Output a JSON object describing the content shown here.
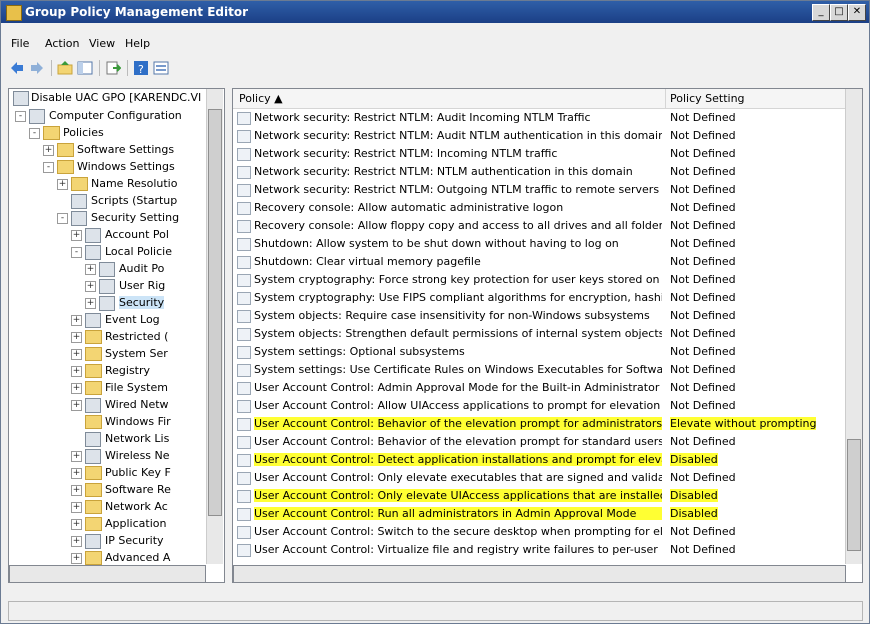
{
  "window": {
    "title": "Group Policy Management Editor"
  },
  "menu": [
    "File",
    "Action",
    "View",
    "Help"
  ],
  "tree": {
    "root": "Disable UAC GPO [KARENDC.VI",
    "items": [
      "Computer Configuration",
      "Policies",
      "Software Settings",
      "Windows Settings",
      "Name Resolutio",
      "Scripts (Startup",
      "Security Setting",
      "Account Pol",
      "Local Policie",
      "Audit Po",
      "User Rig",
      "Security",
      "Event Log",
      "Restricted (",
      "System Ser",
      "Registry",
      "File System",
      "Wired Netw",
      "Windows Fir",
      "Network Lis",
      "Wireless Ne",
      "Public Key F",
      "Software Re",
      "Network Ac",
      "Application",
      "IP Security",
      "Advanced A"
    ]
  },
  "list": {
    "headers": {
      "policy": "Policy",
      "setting": "Policy Setting"
    },
    "rows": [
      {
        "policy": "Network security: Restrict NTLM: Audit Incoming NTLM Traffic",
        "setting": "Not Defined"
      },
      {
        "policy": "Network security: Restrict NTLM: Audit NTLM authentication in this domain",
        "setting": "Not Defined"
      },
      {
        "policy": "Network security: Restrict NTLM: Incoming NTLM traffic",
        "setting": "Not Defined"
      },
      {
        "policy": "Network security: Restrict NTLM: NTLM authentication in this domain",
        "setting": "Not Defined"
      },
      {
        "policy": "Network security: Restrict NTLM: Outgoing NTLM traffic to remote servers",
        "setting": "Not Defined"
      },
      {
        "policy": "Recovery console: Allow automatic administrative logon",
        "setting": "Not Defined"
      },
      {
        "policy": "Recovery console: Allow floppy copy and access to all drives and all folders",
        "setting": "Not Defined"
      },
      {
        "policy": "Shutdown: Allow system to be shut down without having to log on",
        "setting": "Not Defined"
      },
      {
        "policy": "Shutdown: Clear virtual memory pagefile",
        "setting": "Not Defined"
      },
      {
        "policy": "System cryptography: Force strong key protection for user keys stored on t...",
        "setting": "Not Defined"
      },
      {
        "policy": "System cryptography: Use FIPS compliant algorithms for encryption, hashin...",
        "setting": "Not Defined"
      },
      {
        "policy": "System objects: Require case insensitivity for non-Windows subsystems",
        "setting": "Not Defined"
      },
      {
        "policy": "System objects: Strengthen default permissions of internal system objects (...",
        "setting": "Not Defined"
      },
      {
        "policy": "System settings: Optional subsystems",
        "setting": "Not Defined"
      },
      {
        "policy": "System settings: Use Certificate Rules on Windows Executables for Softwar...",
        "setting": "Not Defined"
      },
      {
        "policy": "User Account Control: Admin Approval Mode for the Built-in Administrator ac...",
        "setting": "Not Defined"
      },
      {
        "policy": "User Account Control: Allow UIAccess applications to prompt for elevation w...",
        "setting": "Not Defined"
      },
      {
        "policy": "User Account Control: Behavior of the elevation prompt for administrators i...",
        "setting": "Elevate without prompting",
        "hl": true
      },
      {
        "policy": "User Account Control: Behavior of the elevation prompt for standard users",
        "setting": "Not Defined"
      },
      {
        "policy": "User Account Control: Detect application installations and prompt for elevation",
        "setting": "Disabled",
        "hl": true
      },
      {
        "policy": "User Account Control: Only elevate executables that are signed and validated",
        "setting": "Not Defined"
      },
      {
        "policy": "User Account Control: Only elevate UIAccess applications that are installed i...",
        "setting": "Disabled",
        "hl": true
      },
      {
        "policy": "User Account Control: Run all administrators in Admin Approval Mode",
        "setting": "Disabled",
        "hl": true
      },
      {
        "policy": "User Account Control: Switch to the secure desktop when prompting for ele...",
        "setting": "Not Defined"
      },
      {
        "policy": "User Account Control: Virtualize file and registry write failures to per-user lo...",
        "setting": "Not Defined"
      }
    ]
  },
  "highlight_color": "#ffff33"
}
